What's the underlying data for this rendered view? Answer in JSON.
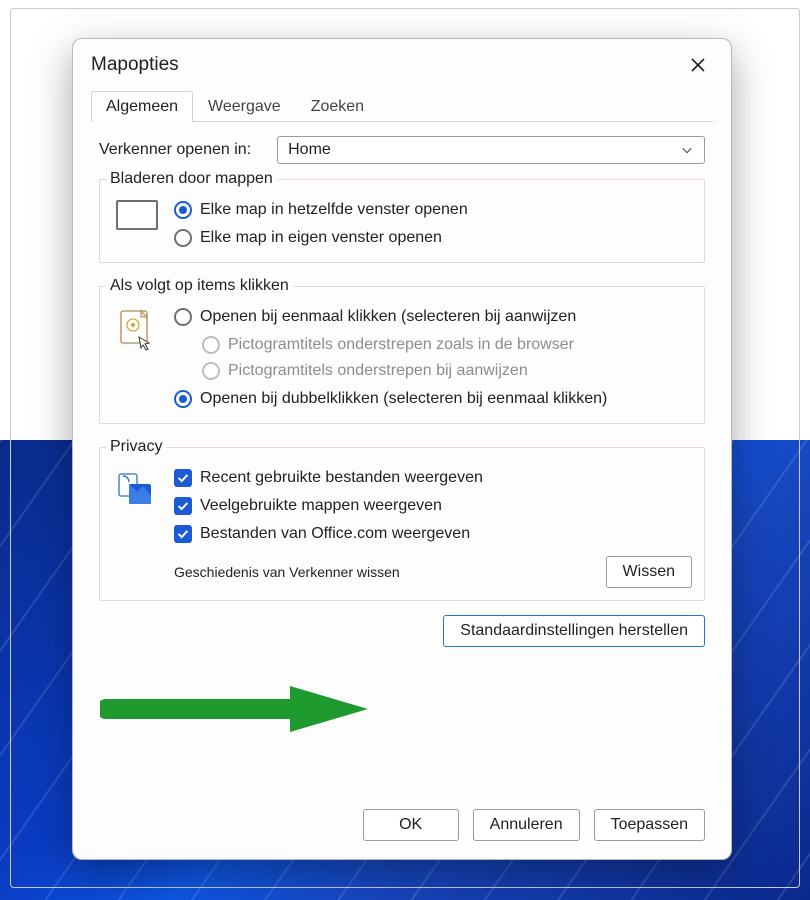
{
  "dialog": {
    "title": "Mapopties",
    "tabs": [
      "Algemeen",
      "Weergave",
      "Zoeken"
    ],
    "active_tab": 0,
    "open_in": {
      "label": "Verkenner openen in:",
      "value": "Home"
    },
    "browse": {
      "legend": "Bladeren door mappen",
      "options": [
        "Elke map in hetzelfde venster openen",
        "Elke map in eigen venster openen"
      ],
      "selected": 0
    },
    "click": {
      "legend": "Als volgt op items klikken",
      "single": "Openen bij eenmaal klikken (selecteren bij aanwijzen",
      "sub1": "Pictogramtitels onderstrepen zoals in de browser",
      "sub2": "Pictogramtitels onderstrepen bij aanwijzen",
      "double": "Openen bij dubbelklikken (selecteren bij eenmaal klikken)",
      "selected": "double"
    },
    "privacy": {
      "legend": "Privacy",
      "items": [
        "Recent gebruikte bestanden weergeven",
        "Veelgebruikte mappen weergeven",
        "Bestanden van Office.com weergeven"
      ],
      "history_label": "Geschiedenis van Verkenner wissen",
      "clear_btn": "Wissen"
    },
    "restore_btn": "Standaardinstellingen herstellen",
    "footer": {
      "ok": "OK",
      "cancel": "Annuleren",
      "apply": "Toepassen"
    }
  }
}
